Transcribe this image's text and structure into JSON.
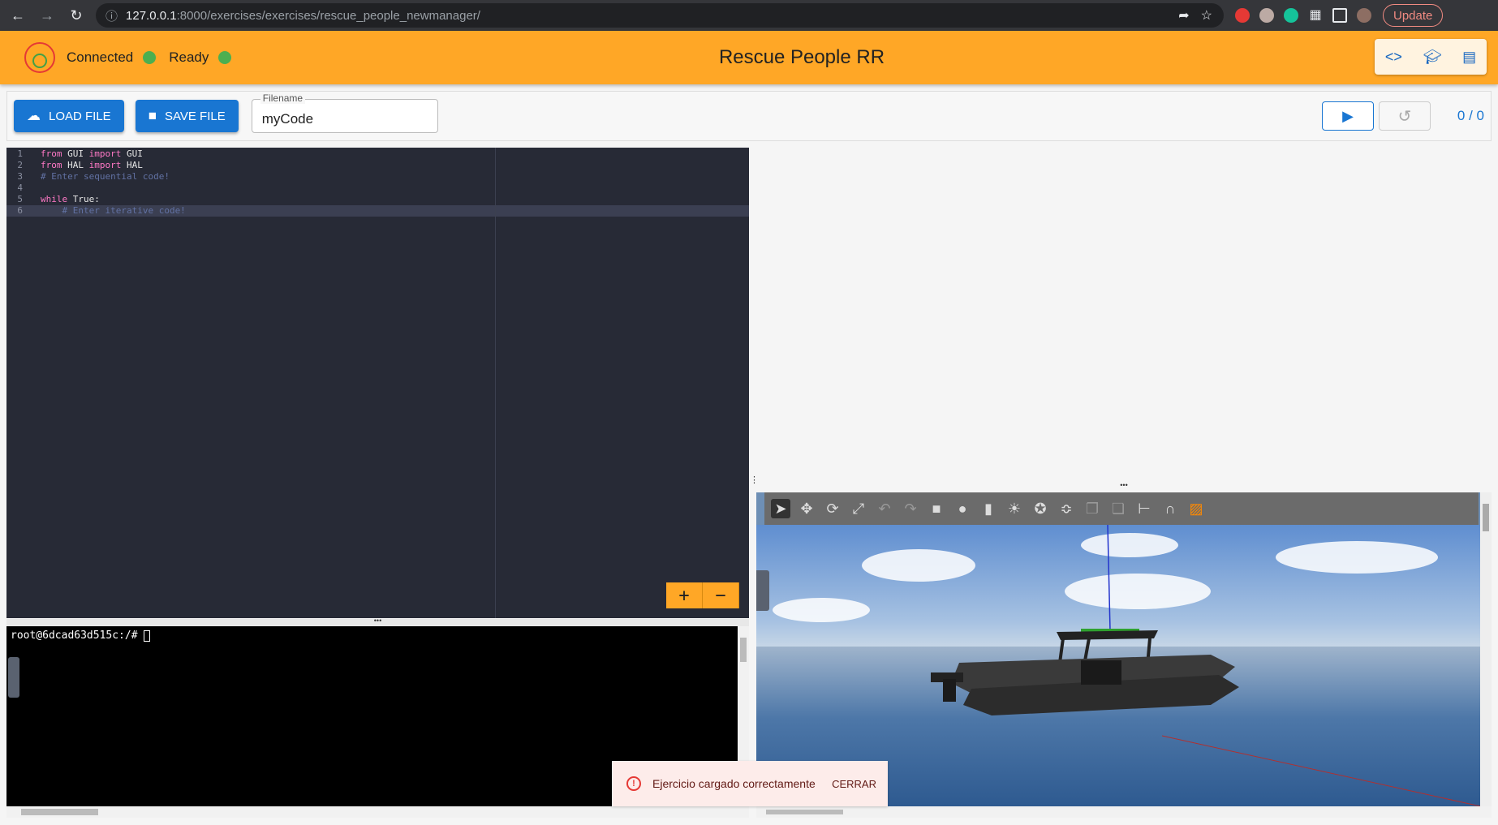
{
  "browser": {
    "url_host": "127.0.0.1",
    "url_path": ":8000/exercises/exercises/rescue_people_newmanager/",
    "update_label": "Update"
  },
  "header": {
    "connected_label": "Connected",
    "ready_label": "Ready",
    "title": "Rescue People RR",
    "status_color": "#4caf50",
    "accent": "#ffa726"
  },
  "toolbar": {
    "load_label": "LOAD FILE",
    "save_label": "SAVE FILE",
    "filename_label": "Filename",
    "filename_value": "myCode",
    "counter": "0 / 0"
  },
  "editor": {
    "lines": [
      {
        "n": "1",
        "parts": [
          {
            "t": "from",
            "c": "kw"
          },
          {
            "t": " GUI ",
            "c": ""
          },
          {
            "t": "import",
            "c": "kw"
          },
          {
            "t": " GUI",
            "c": ""
          }
        ]
      },
      {
        "n": "2",
        "parts": [
          {
            "t": "from",
            "c": "kw"
          },
          {
            "t": " HAL ",
            "c": ""
          },
          {
            "t": "import",
            "c": "kw"
          },
          {
            "t": " HAL",
            "c": ""
          }
        ]
      },
      {
        "n": "3",
        "parts": [
          {
            "t": "# Enter sequential code!",
            "c": "cm"
          }
        ]
      },
      {
        "n": "4",
        "parts": []
      },
      {
        "n": "5",
        "parts": [
          {
            "t": "while",
            "c": "kw"
          },
          {
            "t": " True:",
            "c": ""
          }
        ]
      },
      {
        "n": "6",
        "parts": [
          {
            "t": "    # Enter iterative code!",
            "c": "cm"
          }
        ]
      }
    ]
  },
  "terminal": {
    "prompt": "root@6dcad63d515c:/# "
  },
  "toast": {
    "message": "Ejercicio cargado correctamente",
    "close_label": "CERRAR"
  }
}
